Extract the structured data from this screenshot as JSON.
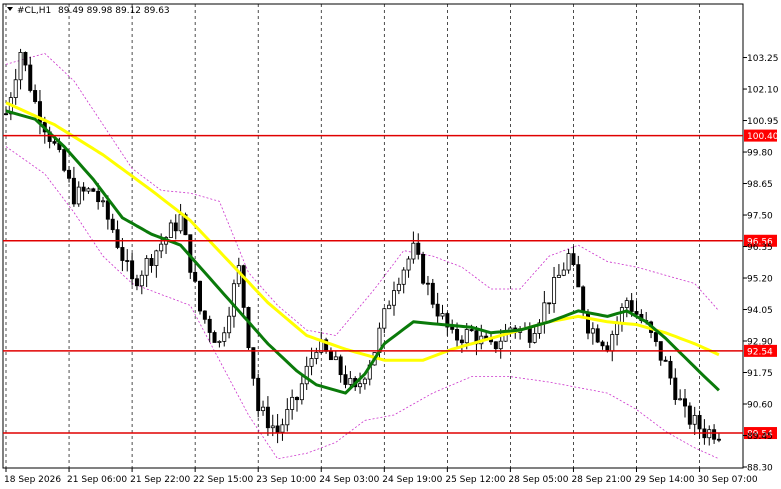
{
  "header": {
    "symbol": "#CL,H1",
    "ohlc": "89.49 89.98 89.12 89.63"
  },
  "colors": {
    "background": "#ffffff",
    "candle": "#000000",
    "grid": "#000000",
    "level_line": "#e00000",
    "level_label_bg": "#ff0000",
    "ma_green": "#0a7a0a",
    "ma_yellow": "#ffff00",
    "bollinger": "#cc33cc"
  },
  "chart_data": {
    "type": "candlestick",
    "ylim": [
      88.3,
      104.0
    ],
    "y_ticks": [
      "103.25",
      "102.10",
      "100.95",
      "99.80",
      "98.65",
      "97.50",
      "96.35",
      "95.20",
      "94.05",
      "92.90",
      "91.75",
      "90.60",
      "89.45",
      "88.30"
    ],
    "x_ticks": [
      "18 Sep 2026",
      "21 Sep 06:00",
      "21 Sep 22:00",
      "22 Sep 15:00",
      "23 Sep 10:00",
      "24 Sep 03:00",
      "24 Sep 19:00",
      "25 Sep 12:00",
      "28 Sep 05:00",
      "28 Sep 21:00",
      "29 Sep 14:00",
      "30 Sep 07:00"
    ],
    "levels": [
      {
        "value": 100.4,
        "label": "100.40"
      },
      {
        "value": 96.56,
        "label": "96.56"
      },
      {
        "value": 92.54,
        "label": "92.54"
      },
      {
        "value": 89.54,
        "label": "89.54"
      }
    ],
    "ohlc_anchors": [
      [
        0,
        101.2
      ],
      [
        3,
        103.5
      ],
      [
        6,
        101.6
      ],
      [
        10,
        100.0
      ],
      [
        14,
        98.2
      ],
      [
        18,
        98.4
      ],
      [
        22,
        97.0
      ],
      [
        26,
        95.0
      ],
      [
        30,
        96.0
      ],
      [
        36,
        97.4
      ],
      [
        40,
        94.0
      ],
      [
        44,
        92.8
      ],
      [
        48,
        95.5
      ],
      [
        52,
        90.4
      ],
      [
        56,
        89.6
      ],
      [
        60,
        90.8
      ],
      [
        64,
        92.8
      ],
      [
        68,
        92.0
      ],
      [
        72,
        91.0
      ],
      [
        76,
        92.6
      ],
      [
        80,
        95.0
      ],
      [
        84,
        96.2
      ],
      [
        88,
        94.4
      ],
      [
        92,
        93.0
      ],
      [
        96,
        93.2
      ],
      [
        100,
        92.6
      ],
      [
        104,
        93.4
      ],
      [
        108,
        93.2
      ],
      [
        112,
        94.5
      ],
      [
        116,
        96.0
      ],
      [
        120,
        93.5
      ],
      [
        124,
        92.8
      ],
      [
        128,
        94.4
      ],
      [
        132,
        93.4
      ],
      [
        136,
        92.0
      ],
      [
        140,
        90.2
      ],
      [
        144,
        89.6
      ],
      [
        147,
        89.6
      ]
    ],
    "ma_yellow": [
      [
        0,
        101.6
      ],
      [
        10,
        100.8
      ],
      [
        20,
        99.7
      ],
      [
        30,
        98.4
      ],
      [
        38,
        97.3
      ],
      [
        46,
        95.8
      ],
      [
        54,
        94.3
      ],
      [
        62,
        93.1
      ],
      [
        70,
        92.6
      ],
      [
        78,
        92.2
      ],
      [
        86,
        92.2
      ],
      [
        92,
        92.6
      ],
      [
        100,
        93.0
      ],
      [
        106,
        93.3
      ],
      [
        112,
        93.6
      ],
      [
        118,
        93.8
      ],
      [
        124,
        93.6
      ],
      [
        130,
        93.5
      ],
      [
        136,
        93.2
      ],
      [
        142,
        92.8
      ],
      [
        147,
        92.4
      ]
    ],
    "ma_green": [
      [
        0,
        101.3
      ],
      [
        6,
        101.0
      ],
      [
        12,
        100.0
      ],
      [
        18,
        98.8
      ],
      [
        24,
        97.4
      ],
      [
        30,
        96.8
      ],
      [
        36,
        96.4
      ],
      [
        42,
        95.2
      ],
      [
        48,
        94.0
      ],
      [
        54,
        92.8
      ],
      [
        60,
        91.8
      ],
      [
        64,
        91.3
      ],
      [
        70,
        91.0
      ],
      [
        74,
        91.7
      ],
      [
        78,
        92.8
      ],
      [
        84,
        93.6
      ],
      [
        90,
        93.5
      ],
      [
        96,
        93.4
      ],
      [
        100,
        93.2
      ],
      [
        106,
        93.3
      ],
      [
        112,
        93.6
      ],
      [
        118,
        94.0
      ],
      [
        124,
        93.8
      ],
      [
        128,
        94.0
      ],
      [
        132,
        93.6
      ],
      [
        136,
        93.0
      ],
      [
        140,
        92.3
      ],
      [
        144,
        91.6
      ],
      [
        147,
        91.1
      ]
    ],
    "bb_upper": [
      [
        0,
        103.0
      ],
      [
        8,
        103.4
      ],
      [
        14,
        102.4
      ],
      [
        20,
        100.8
      ],
      [
        26,
        99.2
      ],
      [
        32,
        98.4
      ],
      [
        38,
        98.3
      ],
      [
        44,
        98.0
      ],
      [
        50,
        95.4
      ],
      [
        56,
        94.2
      ],
      [
        62,
        93.3
      ],
      [
        68,
        93.1
      ],
      [
        76,
        94.8
      ],
      [
        82,
        96.2
      ],
      [
        88,
        96.0
      ],
      [
        94,
        95.6
      ],
      [
        100,
        94.8
      ],
      [
        106,
        94.8
      ],
      [
        112,
        96.0
      ],
      [
        118,
        96.4
      ],
      [
        124,
        95.8
      ],
      [
        130,
        95.6
      ],
      [
        136,
        95.3
      ],
      [
        142,
        95.0
      ],
      [
        147,
        94.0
      ]
    ],
    "bb_lower": [
      [
        0,
        100.0
      ],
      [
        8,
        99.0
      ],
      [
        14,
        97.6
      ],
      [
        20,
        96.0
      ],
      [
        26,
        95.0
      ],
      [
        32,
        94.6
      ],
      [
        38,
        94.2
      ],
      [
        44,
        92.2
      ],
      [
        50,
        90.2
      ],
      [
        56,
        88.6
      ],
      [
        62,
        88.8
      ],
      [
        68,
        89.2
      ],
      [
        74,
        90.0
      ],
      [
        80,
        90.2
      ],
      [
        88,
        91.0
      ],
      [
        96,
        91.6
      ],
      [
        104,
        91.6
      ],
      [
        112,
        91.4
      ],
      [
        118,
        91.2
      ],
      [
        124,
        91.0
      ],
      [
        130,
        90.4
      ],
      [
        136,
        89.6
      ],
      [
        142,
        89.0
      ],
      [
        147,
        88.6
      ]
    ]
  }
}
